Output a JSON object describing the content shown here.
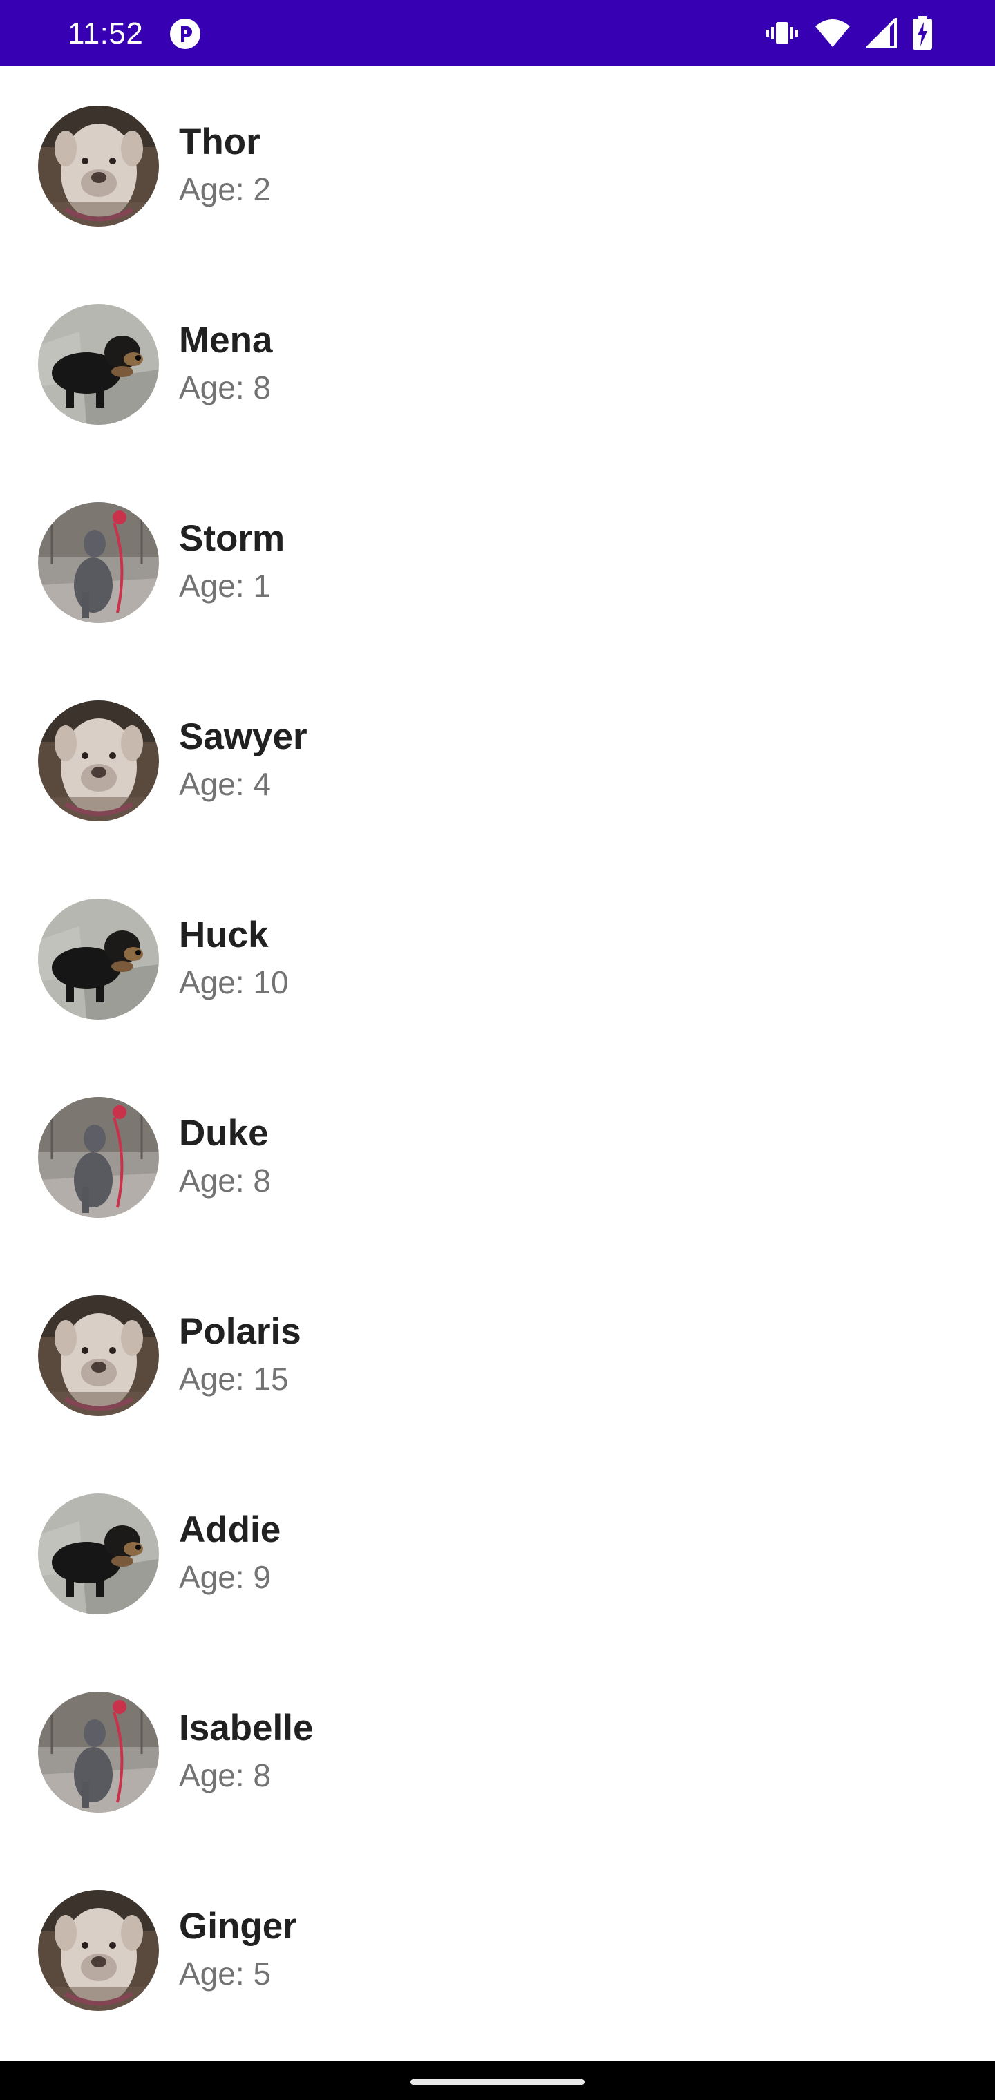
{
  "status_bar": {
    "time": "11:52",
    "background": "#3700b3",
    "icons": [
      "app-notification-icon",
      "vibrate-icon",
      "wifi-icon",
      "cell-signal-icon",
      "battery-charging-icon"
    ]
  },
  "dogs": [
    {
      "name": "Thor",
      "age": "Age: 2",
      "photo": "pitbull-photo"
    },
    {
      "name": "Mena",
      "age": "Age: 8",
      "photo": "black-tan-dog-photo"
    },
    {
      "name": "Storm",
      "age": "Age: 1",
      "photo": "grey-dog-leash-photo"
    },
    {
      "name": "Sawyer",
      "age": "Age: 4",
      "photo": "pitbull-photo"
    },
    {
      "name": "Huck",
      "age": "Age: 10",
      "photo": "black-tan-dog-photo"
    },
    {
      "name": "Duke",
      "age": "Age: 8",
      "photo": "grey-dog-leash-photo"
    },
    {
      "name": "Polaris",
      "age": "Age: 15",
      "photo": "pitbull-photo"
    },
    {
      "name": "Addie",
      "age": "Age: 9",
      "photo": "black-tan-dog-photo"
    },
    {
      "name": "Isabelle",
      "age": "Age: 8",
      "photo": "grey-dog-leash-photo"
    },
    {
      "name": "Ginger",
      "age": "Age: 5",
      "photo": "pitbull-photo"
    }
  ],
  "colors": {
    "name_text": "#212121",
    "age_text": "#737373",
    "nav_bar": "#000000"
  }
}
